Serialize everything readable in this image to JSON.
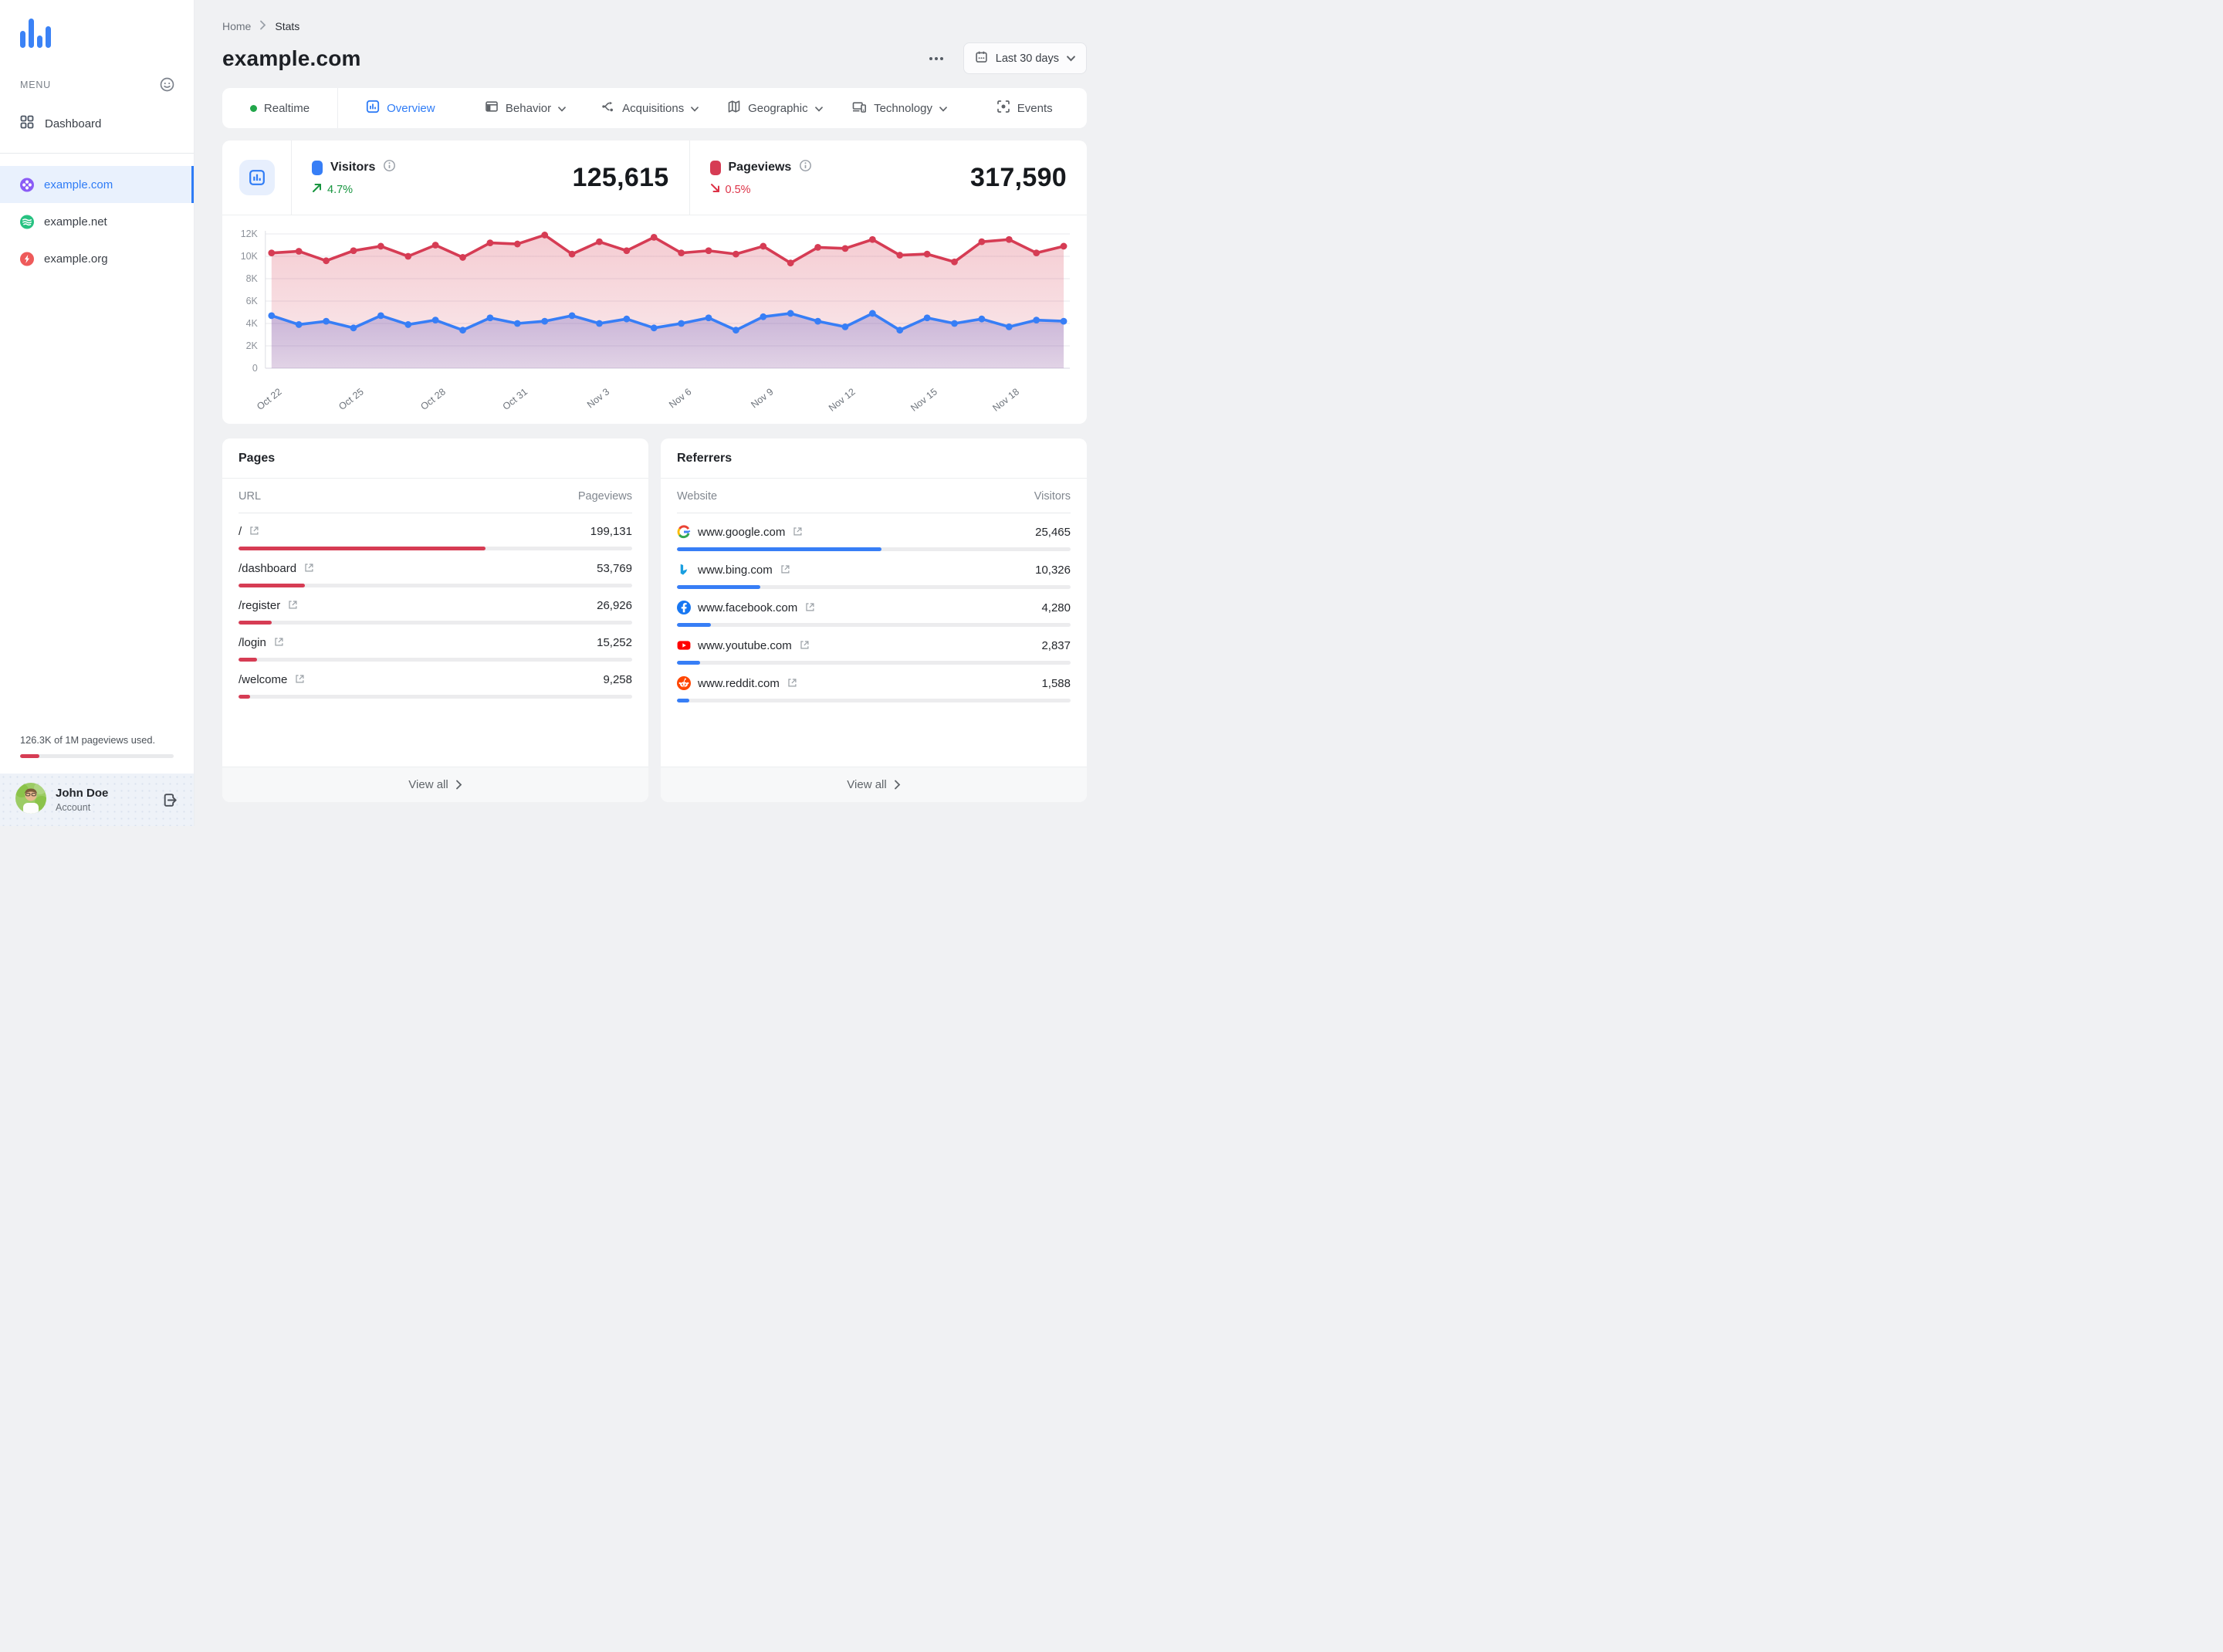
{
  "sidebar": {
    "menu_label": "MENU",
    "dashboard_label": "Dashboard",
    "sites": [
      {
        "label": "example.com",
        "active": true
      },
      {
        "label": "example.net",
        "active": false
      },
      {
        "label": "example.org",
        "active": false
      }
    ],
    "usage_text": "126.3K of 1M pageviews used.",
    "usage_pct": 12.6,
    "user": {
      "name": "John Doe",
      "role": "Account"
    }
  },
  "header": {
    "breadcrumb": {
      "home": "Home",
      "current": "Stats"
    },
    "title": "example.com",
    "date_range": "Last 30 days"
  },
  "tabs": {
    "realtime": "Realtime",
    "overview": "Overview",
    "behavior": "Behavior",
    "acquisitions": "Acquisitions",
    "geographic": "Geographic",
    "technology": "Technology",
    "events": "Events"
  },
  "stats": {
    "visitors": {
      "label": "Visitors",
      "value": "125,615",
      "change": "4.7%",
      "trend": "up",
      "color": "#377ef6"
    },
    "pageviews": {
      "label": "Pageviews",
      "value": "317,590",
      "change": "0.5%",
      "trend": "down",
      "color": "#d63c54"
    }
  },
  "chart_data": {
    "type": "line",
    "title": "Visitors vs Pageviews, last 30 days",
    "x": [
      "Oct 22",
      "Oct 23",
      "Oct 24",
      "Oct 25",
      "Oct 26",
      "Oct 27",
      "Oct 28",
      "Oct 29",
      "Oct 30",
      "Oct 31",
      "Nov 1",
      "Nov 2",
      "Nov 3",
      "Nov 4",
      "Nov 5",
      "Nov 6",
      "Nov 7",
      "Nov 8",
      "Nov 9",
      "Nov 10",
      "Nov 11",
      "Nov 12",
      "Nov 13",
      "Nov 14",
      "Nov 15",
      "Nov 16",
      "Nov 17",
      "Nov 18",
      "Nov 19",
      "Nov 20"
    ],
    "series": [
      {
        "name": "Pageviews",
        "color": "#d63c54",
        "values": [
          10300,
          10450,
          9600,
          10500,
          10900,
          10000,
          11000,
          9900,
          11200,
          11100,
          11900,
          10200,
          11300,
          10500,
          11700,
          10300,
          10500,
          10200,
          10900,
          9400,
          10800,
          10700,
          11500,
          10100,
          10200,
          9500,
          11300,
          11500,
          10300,
          10900
        ]
      },
      {
        "name": "Visitors",
        "color": "#377ef6",
        "values": [
          4700,
          3900,
          4200,
          3600,
          4700,
          3900,
          4300,
          3400,
          4500,
          4000,
          4200,
          4700,
          4000,
          4400,
          3600,
          4000,
          4500,
          3400,
          4600,
          4900,
          4200,
          3700,
          4900,
          3400,
          4500,
          4000,
          4400,
          3700,
          4300,
          4200
        ]
      }
    ],
    "ylim": [
      0,
      12000
    ],
    "yticks": [
      0,
      2000,
      4000,
      6000,
      8000,
      10000,
      12000
    ],
    "ytick_labels": [
      "0",
      "2K",
      "4K",
      "6K",
      "8K",
      "10K",
      "12K"
    ],
    "x_tick_every": 3,
    "grid": "horizontal",
    "legend_position": "none"
  },
  "pages_card": {
    "title": "Pages",
    "col_label": "URL",
    "col_value": "Pageviews",
    "rows": [
      {
        "label": "/",
        "value": "199,131",
        "bar_pct": 62.7
      },
      {
        "label": "/dashboard",
        "value": "53,769",
        "bar_pct": 16.9
      },
      {
        "label": "/register",
        "value": "26,926",
        "bar_pct": 8.5
      },
      {
        "label": "/login",
        "value": "15,252",
        "bar_pct": 4.8
      },
      {
        "label": "/welcome",
        "value": "9,258",
        "bar_pct": 2.9
      }
    ],
    "view_all": "View all"
  },
  "referrers_card": {
    "title": "Referrers",
    "col_label": "Website",
    "col_value": "Visitors",
    "rows": [
      {
        "icon": "google-favicon",
        "label": "www.google.com",
        "value": "25,465",
        "bar_pct": 52.0
      },
      {
        "icon": "bing-favicon",
        "label": "www.bing.com",
        "value": "10,326",
        "bar_pct": 21.1
      },
      {
        "icon": "facebook-favicon",
        "label": "www.facebook.com",
        "value": "4,280",
        "bar_pct": 8.7
      },
      {
        "icon": "youtube-favicon",
        "label": "www.youtube.com",
        "value": "2,837",
        "bar_pct": 5.8
      },
      {
        "icon": "reddit-favicon",
        "label": "www.reddit.com",
        "value": "1,588",
        "bar_pct": 3.2
      }
    ],
    "view_all": "View all"
  },
  "colors": {
    "accent_blue": "#377ef6",
    "accent_red": "#d63c54",
    "green": "#17953f",
    "active_item_bg": "#e9f1fd"
  }
}
